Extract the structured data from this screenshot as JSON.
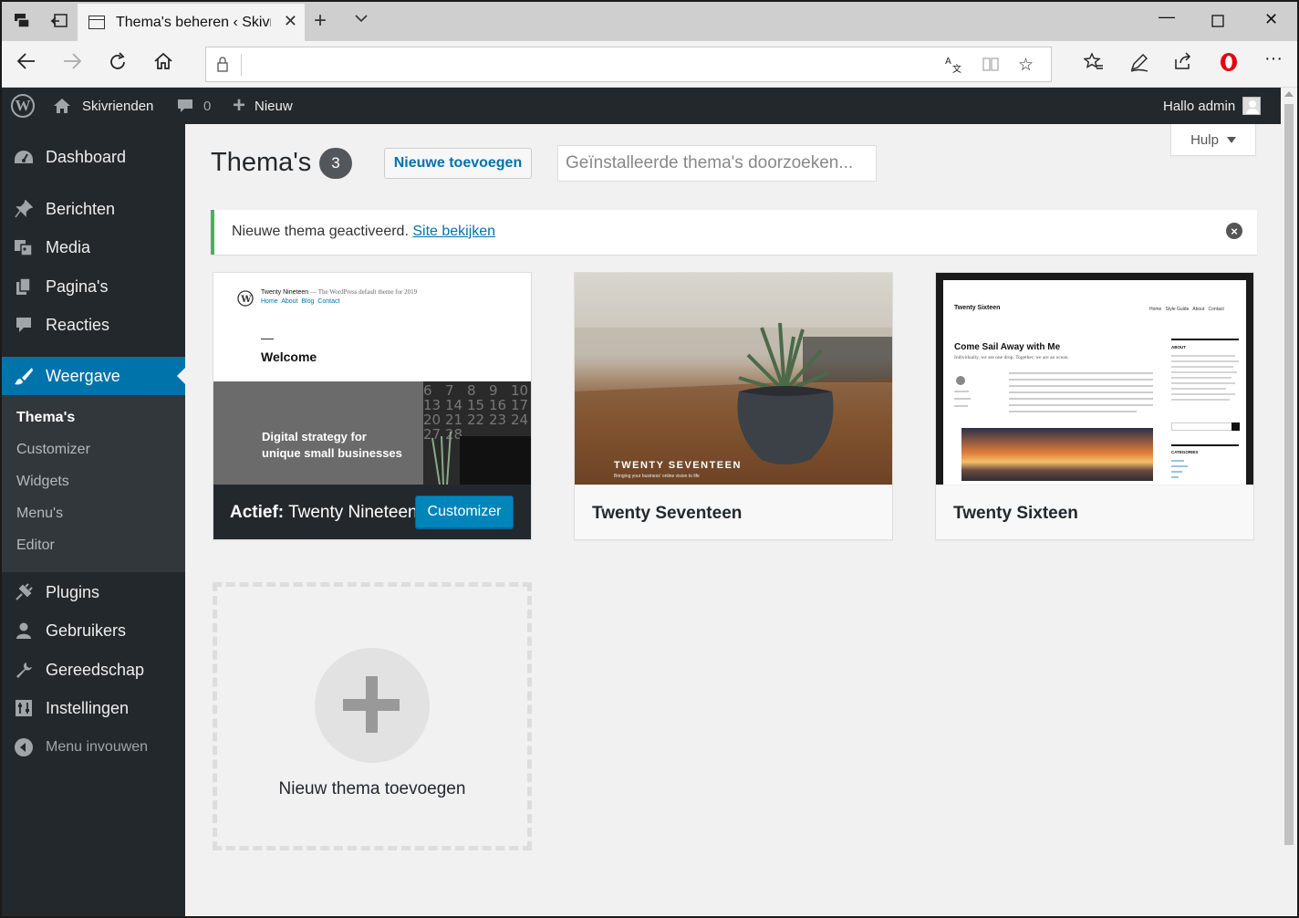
{
  "browser": {
    "tab_title": "Thema's beheren ‹ Skivr",
    "url": ""
  },
  "adminbar": {
    "site_name": "Skivrienden",
    "comments_count": "0",
    "new_label": "Nieuw",
    "greeting": "Hallo admin"
  },
  "sidebar": {
    "items": [
      {
        "label": "Dashboard",
        "icon": "dashboard-icon"
      },
      {
        "label": "Berichten",
        "icon": "pin-icon"
      },
      {
        "label": "Media",
        "icon": "media-icon"
      },
      {
        "label": "Pagina's",
        "icon": "pages-icon"
      },
      {
        "label": "Reacties",
        "icon": "comment-icon"
      },
      {
        "label": "Weergave",
        "icon": "brush-icon"
      },
      {
        "label": "Plugins",
        "icon": "plug-icon"
      },
      {
        "label": "Gebruikers",
        "icon": "user-icon"
      },
      {
        "label": "Gereedschap",
        "icon": "wrench-icon"
      },
      {
        "label": "Instellingen",
        "icon": "settings-icon"
      },
      {
        "label": "Menu invouwen",
        "icon": "collapse-icon"
      }
    ],
    "submenu": [
      "Thema's",
      "Customizer",
      "Widgets",
      "Menu's",
      "Editor"
    ]
  },
  "main": {
    "help_label": "Hulp",
    "title": "Thema's",
    "count": "3",
    "add_new_label": "Nieuwe toevoegen",
    "search_placeholder": "Geïnstalleerde thema's doorzoeken...",
    "notice": {
      "text": "Nieuwe thema geactiveerd.",
      "link": "Site bekijken"
    },
    "themes": [
      {
        "name": "Twenty Nineteen",
        "active_prefix": "Actief:",
        "customize_label": "Customizer",
        "preview": {
          "site_title": "Twenty Nineteen",
          "tagline": "— The WordPress default theme for 2019",
          "nav": [
            "Home",
            "About",
            "Blog",
            "Contact"
          ],
          "heading": "Welcome",
          "hero_text_1": "Digital strategy for",
          "hero_text_2": "unique small businesses",
          "calendar": [
            "6",
            "7",
            "8",
            "9",
            "10",
            "13",
            "14",
            "15",
            "16",
            "17",
            "20",
            "21",
            "22",
            "23",
            "24",
            "27",
            "28"
          ]
        }
      },
      {
        "name": "Twenty Seventeen",
        "preview": {
          "title": "TWENTY SEVENTEEN",
          "tagline": "Bringing your business' online vision to life"
        }
      },
      {
        "name": "Twenty Sixteen",
        "preview": {
          "site_title": "Twenty Sixteen",
          "nav": [
            "Home",
            "Style Guide",
            "About",
            "Contact"
          ],
          "post_title": "Come Sail Away with Me",
          "post_sub": "Individually, we are one drop. Together, we are an ocean.",
          "sidebar_heading_1": "ABOUT",
          "sidebar_heading_2": "CATEGORIES"
        }
      }
    ],
    "add_theme_label": "Nieuw thema toevoegen"
  },
  "colors": {
    "admin_dark": "#23282d",
    "admin_blue": "#0073aa",
    "notice_green": "#46b450"
  }
}
